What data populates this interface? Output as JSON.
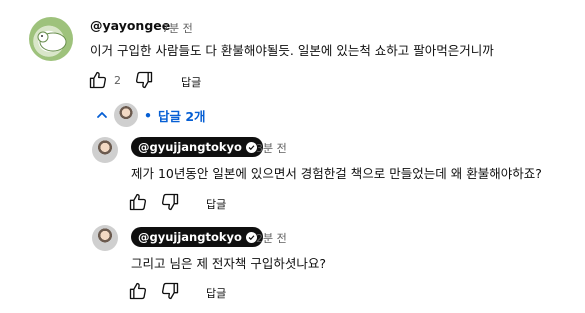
{
  "comment": {
    "username": "@yayongee",
    "time": "7분 전",
    "text": "이거 구입한 사람들도 다 환불해야될듯. 일본에 있는척 쇼하고 팔아먹은거니까",
    "like_count": "2",
    "reply_label": "답글"
  },
  "replies_toggle": {
    "label": "답글 2개"
  },
  "replies": [
    {
      "username": "@gyujjangtokyo",
      "time": "3분 전",
      "text": "제가 10년동안 일본에 있으면서 경험한걸 책으로 만들었는데 왜 환불해야하죠?",
      "reply_label": "답글"
    },
    {
      "username": "@gyujjangtokyo",
      "time": "2분 전",
      "text": "그리고 님은 제 전자책 구입하셧나요?",
      "reply_label": "답글"
    }
  ],
  "colors": {
    "text": "#0f0f0f",
    "muted": "#606060",
    "accent": "#065fd4",
    "chip": "#0f0f0f"
  }
}
